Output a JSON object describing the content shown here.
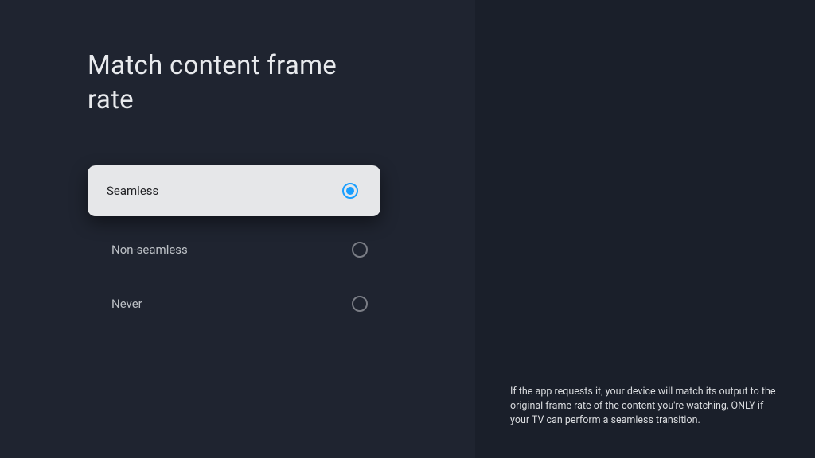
{
  "title": "Match content frame rate",
  "options": [
    {
      "label": "Seamless",
      "selected": true
    },
    {
      "label": "Non-seamless",
      "selected": false
    },
    {
      "label": "Never",
      "selected": false
    }
  ],
  "description": "If the app requests it, your device will match its output to the original frame rate of the content you're watching, ONLY if your TV can perform a seamless transition."
}
